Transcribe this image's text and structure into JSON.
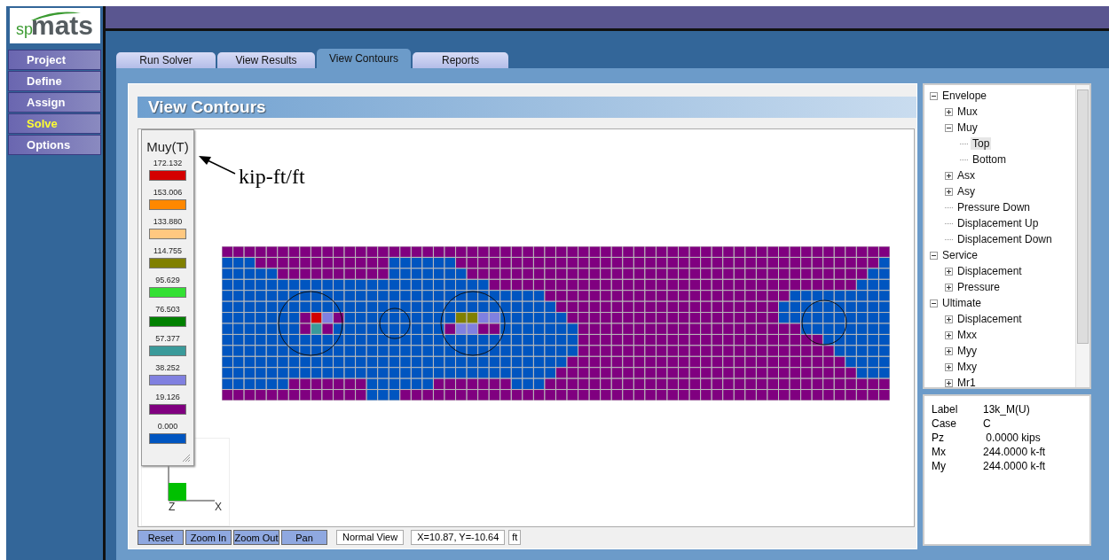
{
  "logo": {
    "prefix": "sp",
    "name": "mats"
  },
  "menu": [
    {
      "label": "Project",
      "selected": false
    },
    {
      "label": "Define",
      "selected": false
    },
    {
      "label": "Assign",
      "selected": false
    },
    {
      "label": "Solve",
      "selected": true
    },
    {
      "label": "Options",
      "selected": false
    }
  ],
  "tabs": [
    {
      "label": "Run Solver",
      "selected": false
    },
    {
      "label": "View Results",
      "selected": false
    },
    {
      "label": "View Contours",
      "selected": true
    },
    {
      "label": "Reports",
      "selected": false
    }
  ],
  "panel_title": "View Contours",
  "legend": {
    "title": "Muy(T)",
    "entries": [
      {
        "value": "172.132",
        "color": "#d40000"
      },
      {
        "value": "153.006",
        "color": "#ff8800"
      },
      {
        "value": "133.880",
        "color": "#ffc880"
      },
      {
        "value": "114.755",
        "color": "#808000"
      },
      {
        "value": "95.629",
        "color": "#33e033"
      },
      {
        "value": "76.503",
        "color": "#008000"
      },
      {
        "value": "57.377",
        "color": "#3a9a9a"
      },
      {
        "value": "38.252",
        "color": "#8080e0"
      },
      {
        "value": "19.126",
        "color": "#800080"
      },
      {
        "value": "0.000",
        "color": "#0055c0"
      }
    ]
  },
  "annotation": "kip-ft/ft",
  "axes": {
    "vertical": "Z",
    "horizontal": "X"
  },
  "tree": [
    {
      "label": "Envelope",
      "expanded": true,
      "selected": false,
      "children": [
        {
          "label": "Mux",
          "expanded": false,
          "selected": false
        },
        {
          "label": "Muy",
          "expanded": true,
          "selected": false,
          "children": [
            {
              "label": "Top",
              "selected": true
            },
            {
              "label": "Bottom",
              "selected": false
            }
          ]
        },
        {
          "label": "Asx",
          "expanded": false,
          "selected": false
        },
        {
          "label": "Asy",
          "expanded": false,
          "selected": false
        },
        {
          "label": "Pressure Down",
          "selected": false
        },
        {
          "label": "Displacement Up",
          "selected": false
        },
        {
          "label": "Displacement Down",
          "selected": false
        }
      ]
    },
    {
      "label": "Service",
      "expanded": true,
      "selected": false,
      "children": [
        {
          "label": "Displacement",
          "expanded": false,
          "selected": false
        },
        {
          "label": "Pressure",
          "expanded": false,
          "selected": false
        }
      ]
    },
    {
      "label": "Ultimate",
      "expanded": true,
      "selected": false,
      "children": [
        {
          "label": "Displacement",
          "expanded": false,
          "selected": false
        },
        {
          "label": "Mxx",
          "expanded": false,
          "selected": false
        },
        {
          "label": "Myy",
          "expanded": false,
          "selected": false
        },
        {
          "label": "Mxy",
          "expanded": false,
          "selected": false
        },
        {
          "label": "Mr1",
          "expanded": false,
          "selected": false
        }
      ]
    }
  ],
  "info": [
    {
      "label": "Label",
      "value": "13k_M(U)"
    },
    {
      "label": "Case",
      "value": "C"
    },
    {
      "label": "Pz",
      "value": " 0.0000 kips"
    },
    {
      "label": "Mx",
      "value": "244.0000 k-ft"
    },
    {
      "label": "My",
      "value": "244.0000 k-ft"
    }
  ],
  "toolbar": [
    "Reset",
    "Zoom In",
    "Zoom Out",
    "Pan"
  ],
  "status": {
    "view": "Normal View",
    "coordinates": "X=10.87, Y=-10.64",
    "unit": "ft"
  }
}
